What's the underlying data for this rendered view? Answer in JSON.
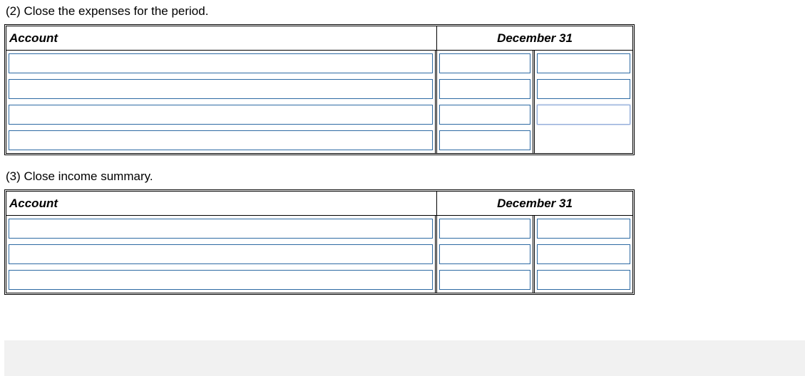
{
  "section2": {
    "prompt": "(2) Close the expenses for the period.",
    "headers": {
      "account": "Account",
      "date": "December 31"
    },
    "rows": [
      {
        "account": "",
        "debit": "",
        "credit": ""
      },
      {
        "account": "",
        "debit": "",
        "credit": ""
      },
      {
        "account": "",
        "debit": "",
        "credit": ""
      },
      {
        "account": "",
        "debit": "",
        "credit": ""
      }
    ]
  },
  "section3": {
    "prompt": "(3) Close income summary.",
    "headers": {
      "account": "Account",
      "date": "December 31"
    },
    "rows": [
      {
        "account": "",
        "debit": "",
        "credit": ""
      },
      {
        "account": "",
        "debit": "",
        "credit": ""
      },
      {
        "account": "",
        "debit": "",
        "credit": ""
      }
    ]
  }
}
